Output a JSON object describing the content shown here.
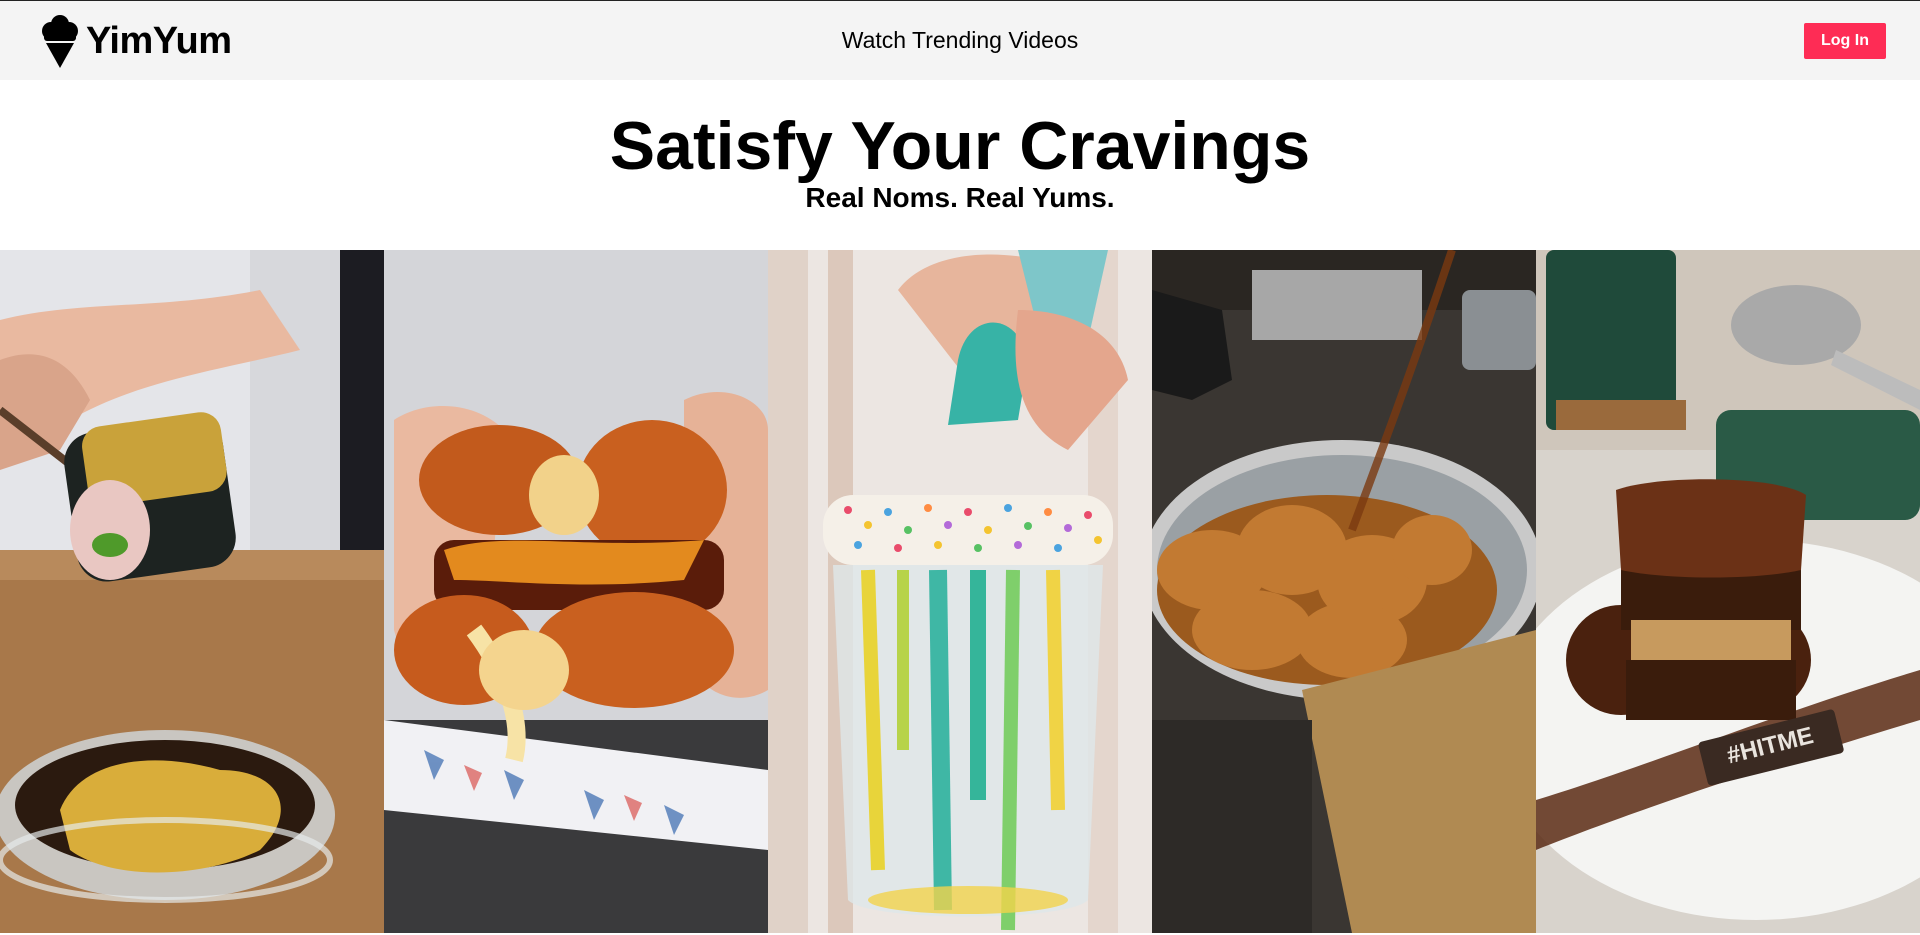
{
  "header": {
    "brand": "YimYum",
    "brand_icon": "ice-cream-cone-icon",
    "nav_link": "Watch Trending Videos",
    "login_label": "Log In",
    "accent_color": "#fe2c55",
    "background_color": "#f4f4f4"
  },
  "hero": {
    "title": "Satisfy Your Cravings",
    "subtitle": "Real Noms. Real Yums."
  },
  "gallery": {
    "videos": [
      {
        "subject": "gold-leaf sushi roll with dipping sauce"
      },
      {
        "subject": "cheesy fried mozzarella burger"
      },
      {
        "subject": "rainbow sprinkle drip jar"
      },
      {
        "subject": "fried chicken in steel bowl"
      },
      {
        "subject": "chocolate layer cake slice",
        "caption": "#HITME"
      }
    ]
  }
}
